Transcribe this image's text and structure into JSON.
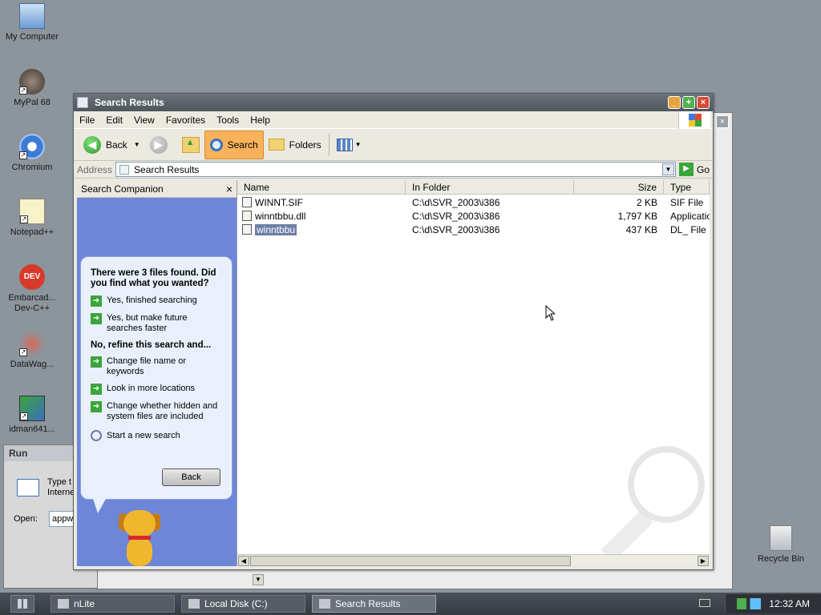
{
  "desktop": {
    "icons": [
      {
        "label": "My Computer"
      },
      {
        "label": "MyPal 68"
      },
      {
        "label": "Chromium"
      },
      {
        "label": "Notepad++"
      },
      {
        "label": "Embarcad... Dev-C++"
      },
      {
        "label": "DataWag..."
      },
      {
        "label": "idman641..."
      },
      {
        "label": "Recycle Bin"
      }
    ]
  },
  "run_dialog": {
    "title": "Run",
    "desc": "Type t Interne",
    "open_label": "Open:",
    "open_value": "appw"
  },
  "window": {
    "title": "Search Results",
    "menu": [
      "File",
      "Edit",
      "View",
      "Favorites",
      "Tools",
      "Help"
    ],
    "toolbar": {
      "back": "Back",
      "search": "Search",
      "folders": "Folders"
    },
    "address": {
      "label": "Address",
      "value": "Search Results",
      "go": "Go"
    },
    "companion": {
      "title": "Search Companion",
      "close": "×",
      "question": "There were 3 files found. Did you find what you wanted?",
      "options_yes": [
        "Yes, finished searching",
        "Yes, but make future searches faster"
      ],
      "refine_header": "No, refine this search and...",
      "options_refine": [
        "Change file name or keywords",
        "Look in more locations",
        "Change whether hidden and system files are included"
      ],
      "new_search": "Start a new search",
      "back_button": "Back"
    },
    "columns": [
      "Name",
      "In Folder",
      "Size",
      "Type"
    ],
    "files": [
      {
        "name": "WINNT.SIF",
        "folder": "C:\\d\\SVR_2003\\i386",
        "size": "2 KB",
        "type": "SIF File"
      },
      {
        "name": "winntbbu.dll",
        "folder": "C:\\d\\SVR_2003\\i386",
        "size": "1,797 KB",
        "type": "Applicatio"
      },
      {
        "name": "winntbbu",
        "folder": "C:\\d\\SVR_2003\\i386",
        "size": "437 KB",
        "type": "DL_ File"
      }
    ]
  },
  "taskbar": {
    "tasks": [
      "nLite",
      "Local Disk (C:)",
      "Search Results"
    ],
    "clock": "12:32 AM"
  }
}
